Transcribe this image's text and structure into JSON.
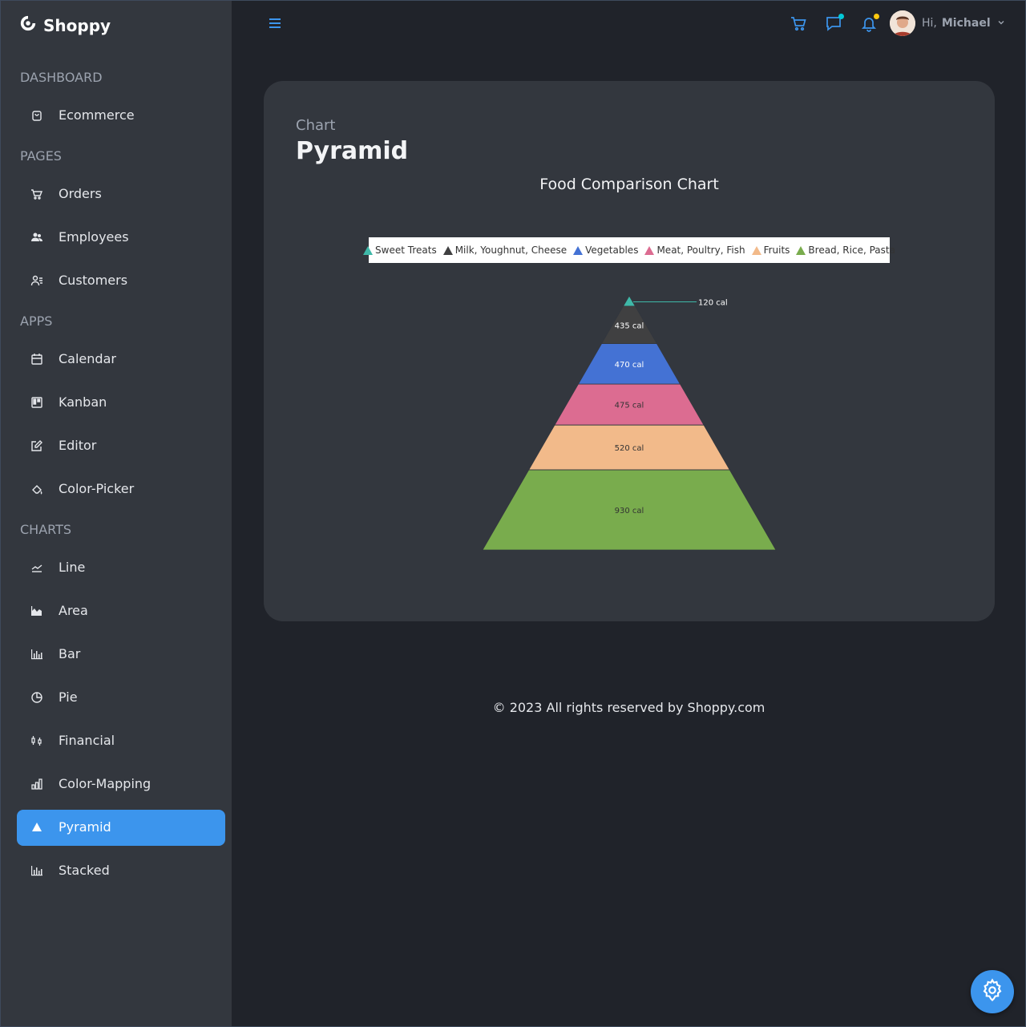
{
  "brand": {
    "name": "Shoppy"
  },
  "sidebar": {
    "sections": [
      {
        "title": "DASHBOARD",
        "items": [
          {
            "label": "Ecommerce",
            "icon": "shopping-bag-icon"
          }
        ]
      },
      {
        "title": "PAGES",
        "items": [
          {
            "label": "Orders",
            "icon": "cart-icon"
          },
          {
            "label": "Employees",
            "icon": "employees-icon"
          },
          {
            "label": "Customers",
            "icon": "customers-icon"
          }
        ]
      },
      {
        "title": "APPS",
        "items": [
          {
            "label": "Calendar",
            "icon": "calendar-icon"
          },
          {
            "label": "Kanban",
            "icon": "kanban-icon"
          },
          {
            "label": "Editor",
            "icon": "edit-icon"
          },
          {
            "label": "Color-Picker",
            "icon": "color-picker-icon"
          }
        ]
      },
      {
        "title": "CHARTS",
        "items": [
          {
            "label": "Line",
            "icon": "line-chart-icon"
          },
          {
            "label": "Area",
            "icon": "area-chart-icon"
          },
          {
            "label": "Bar",
            "icon": "bar-chart-icon"
          },
          {
            "label": "Pie",
            "icon": "pie-chart-icon"
          },
          {
            "label": "Financial",
            "icon": "financial-icon"
          },
          {
            "label": "Color-Mapping",
            "icon": "color-mapping-icon"
          },
          {
            "label": "Pyramid",
            "icon": "pyramid-icon",
            "active": true
          },
          {
            "label": "Stacked",
            "icon": "stacked-chart-icon"
          }
        ]
      }
    ]
  },
  "topbar": {
    "menu_icon": "hamburger-icon",
    "cart_icon": "cart-icon",
    "chat_icon": "chat-icon",
    "notification_icon": "bell-icon",
    "greeting": "Hi,",
    "user_name": "Michael",
    "accent_color": "#3c95ed",
    "chat_dot_color": "#03c9d7",
    "notification_dot_color": "#fec90f"
  },
  "page": {
    "category": "Chart",
    "title": "Pyramid"
  },
  "chart_data": {
    "type": "pyramid",
    "title": "Food Comparison Chart",
    "legend_position": "top",
    "series": [
      {
        "name": "Sweet Treats",
        "value": 120,
        "label": "120 cal",
        "color": "#3fb8a8"
      },
      {
        "name": "Milk, Youghnut, Cheese",
        "value": 435,
        "label": "435 cal",
        "color": "#404041"
      },
      {
        "name": "Vegetables",
        "value": 470,
        "label": "470 cal",
        "color": "#4472d4"
      },
      {
        "name": "Meat, Poultry, Fish",
        "value": 475,
        "label": "475 cal",
        "color": "#dc6c91"
      },
      {
        "name": "Fruits",
        "value": 520,
        "label": "520 cal",
        "color": "#f2ba8a"
      },
      {
        "name": "Bread, Rice, Pasta",
        "value": 930,
        "label": "930 cal",
        "color": "#79ac4d"
      }
    ]
  },
  "footer": {
    "text": "© 2023 All rights reserved by Shoppy.com"
  },
  "settings_icon": "gear-icon"
}
